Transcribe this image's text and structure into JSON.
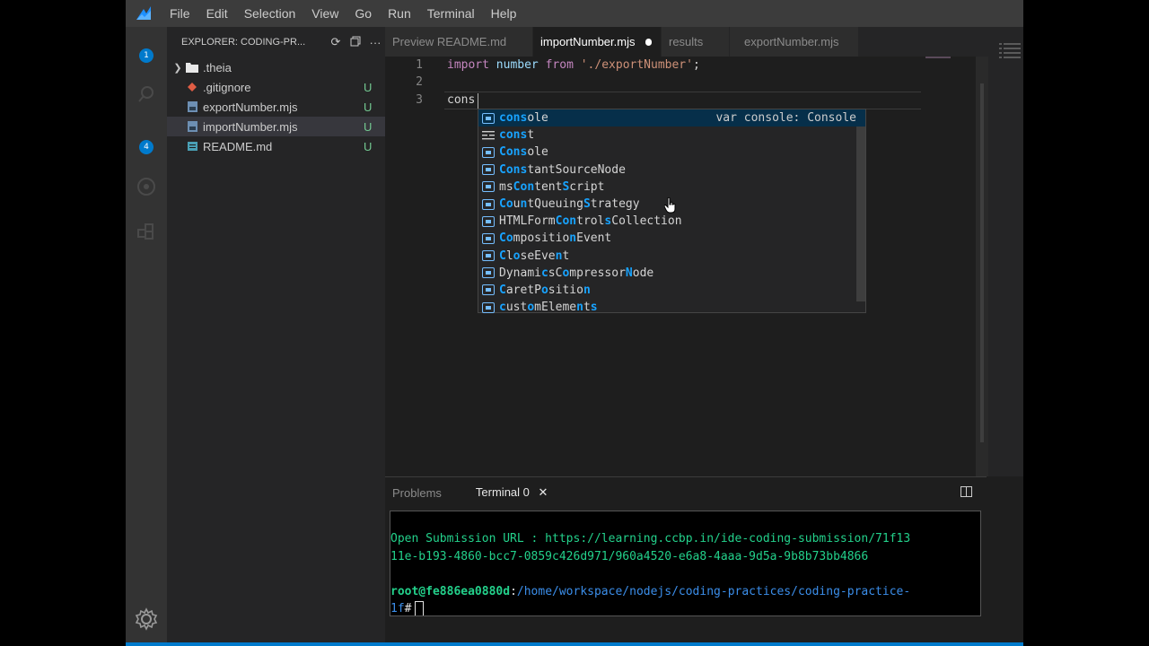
{
  "menubar": {
    "items": [
      "File",
      "Edit",
      "Selection",
      "View",
      "Go",
      "Run",
      "Terminal",
      "Help"
    ]
  },
  "activity": {
    "badges": [
      "1",
      "4"
    ]
  },
  "explorer": {
    "title": "EXPLORER: CODING-PR...",
    "files": [
      {
        "name": ".theia",
        "status": "",
        "type": "folder"
      },
      {
        "name": ".gitignore",
        "status": "U",
        "type": "git"
      },
      {
        "name": "exportNumber.mjs",
        "status": "U",
        "type": "js"
      },
      {
        "name": "importNumber.mjs",
        "status": "U",
        "type": "js",
        "selected": true
      },
      {
        "name": "README.md",
        "status": "U",
        "type": "md"
      }
    ]
  },
  "tabs": [
    {
      "label": "Preview README.md",
      "active": false
    },
    {
      "label": "importNumber.mjs",
      "active": true,
      "dirty": true
    },
    {
      "label": "results",
      "active": false
    },
    {
      "label": "exportNumber.mjs",
      "active": false
    }
  ],
  "editor": {
    "line_numbers": [
      "1",
      "2",
      "3"
    ],
    "line1": {
      "kw1": "import",
      "id": "number",
      "kw2": "from",
      "str": "'./exportNumber'",
      "end": ";"
    },
    "line3": "cons"
  },
  "suggest": {
    "focused_detail": "var console: Console",
    "items": [
      "console",
      "const",
      "Console",
      "ConstantSourceNode",
      "msContentScript",
      "CountQueuingStrategy",
      "HTMLFormControlsCollection",
      "CompositionEvent",
      "CloseEvent",
      "DynamicsCompressorNode",
      "CaretPosition",
      "customElements"
    ]
  },
  "panel": {
    "tabs": [
      "Problems",
      "Terminal 0"
    ],
    "terminal": {
      "line1": "Open Submission URL : https://learning.ccbp.in/ide-coding-submission/71f13",
      "line2": "11e-b193-4860-bcc7-0859c426d971/960a4520-e6a8-4aaa-9d5a-9b8b73bb4866",
      "user": "root@fe886ea0880d",
      "colon": ":",
      "path1": "/home/workspace/nodejs/coding-practices/coding-practice-",
      "path2": "1f",
      "prompt": "#"
    }
  },
  "colors": {
    "accent": "#007acc",
    "untracked": "#73c991",
    "match_highlight": "#18a3ff"
  }
}
